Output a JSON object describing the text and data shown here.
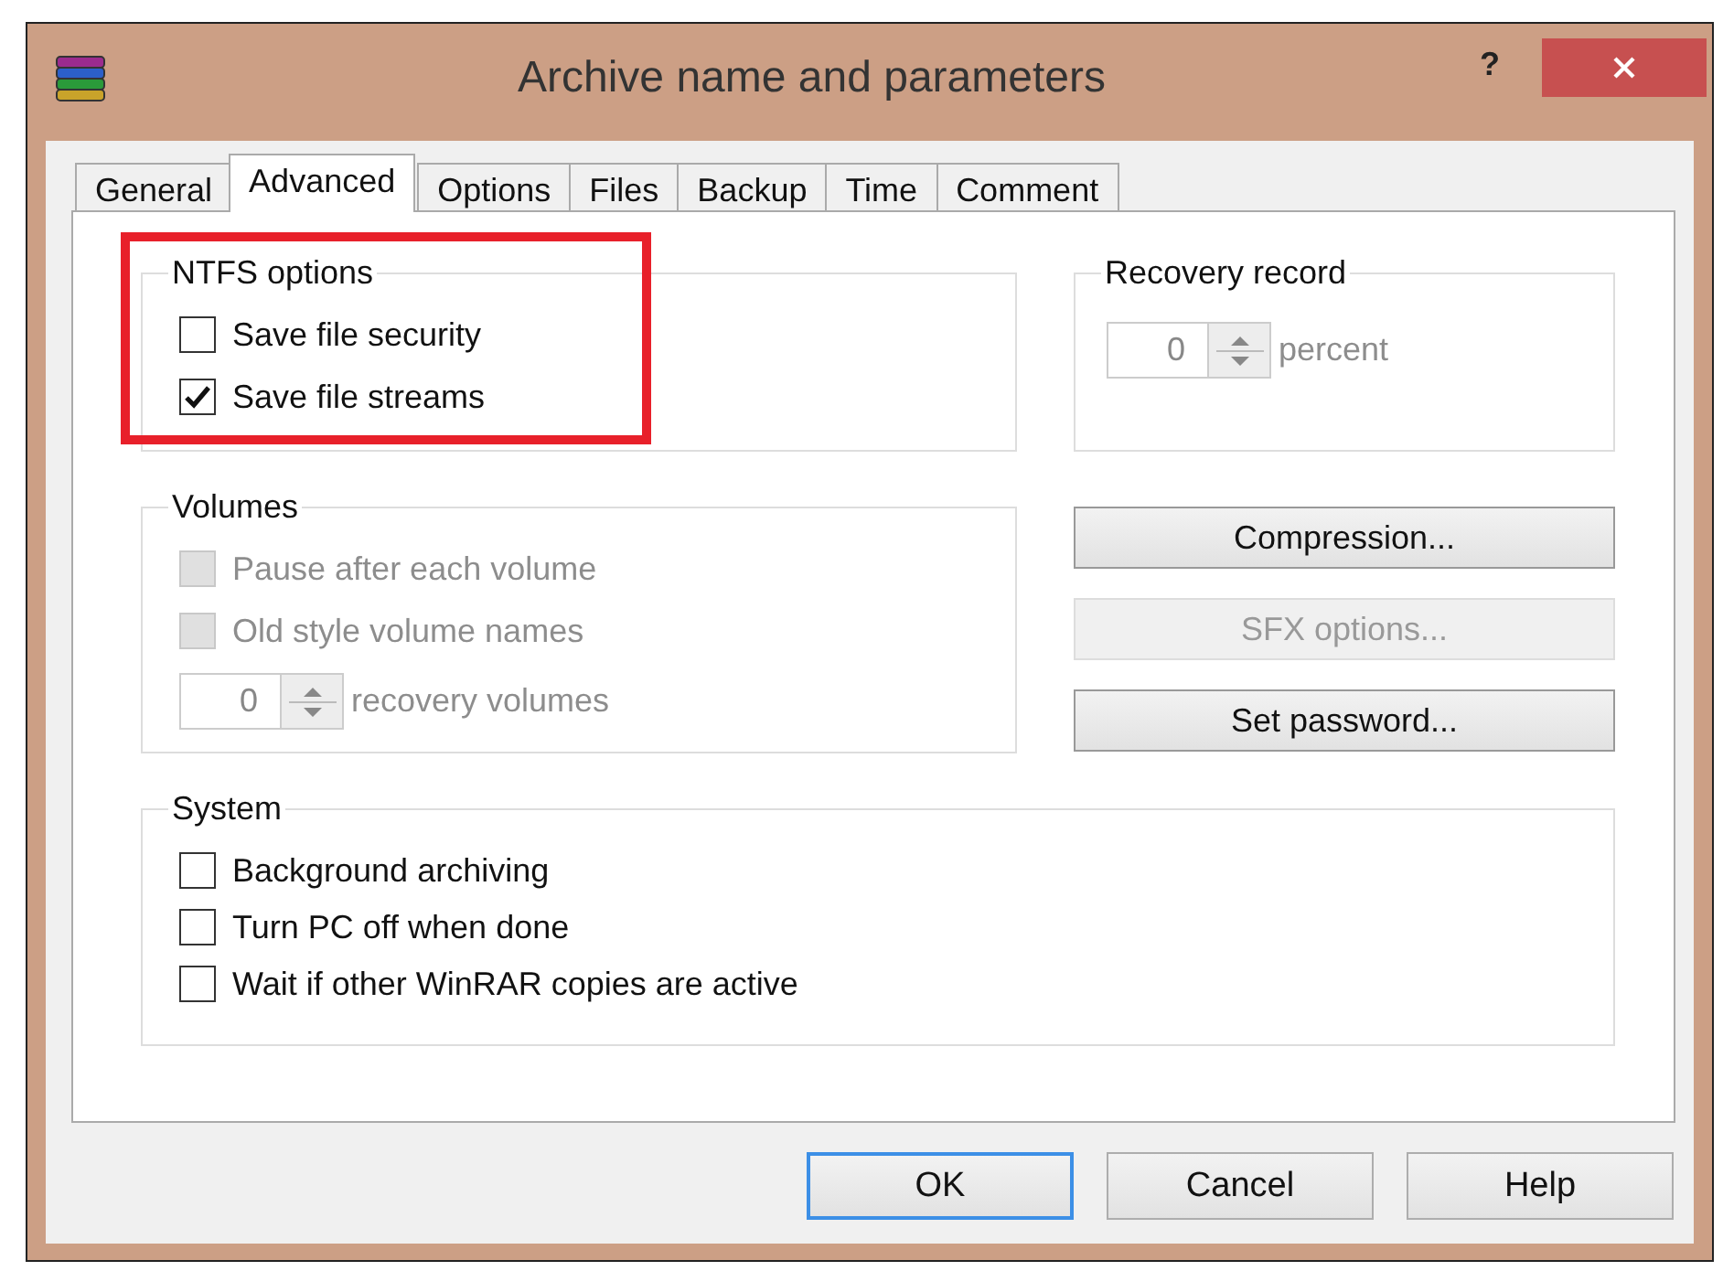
{
  "window": {
    "title": "Archive name and parameters",
    "help": "?"
  },
  "tabs": [
    {
      "label": "General",
      "selected": false
    },
    {
      "label": "Advanced",
      "selected": true
    },
    {
      "label": "Options",
      "selected": false
    },
    {
      "label": "Files",
      "selected": false
    },
    {
      "label": "Backup",
      "selected": false
    },
    {
      "label": "Time",
      "selected": false
    },
    {
      "label": "Comment",
      "selected": false
    }
  ],
  "ntfs_options": {
    "title": "NTFS options",
    "highlighted": true,
    "items": [
      {
        "label": "Save file security",
        "checked": false,
        "disabled": false
      },
      {
        "label": "Save file streams",
        "checked": true,
        "disabled": false
      }
    ]
  },
  "recovery_record": {
    "title": "Recovery record",
    "spinner": {
      "value": "0",
      "unit": "percent",
      "disabled": true
    }
  },
  "volumes": {
    "title": "Volumes",
    "items": [
      {
        "label": "Pause after each volume",
        "checked": false,
        "disabled": true
      },
      {
        "label": "Old style volume names",
        "checked": false,
        "disabled": true
      }
    ],
    "spinner": {
      "value": "0",
      "unit": "recovery volumes",
      "disabled": true
    }
  },
  "side_buttons": [
    {
      "label": "Compression...",
      "disabled": false
    },
    {
      "label": "SFX options...",
      "disabled": true
    },
    {
      "label": "Set password...",
      "disabled": false
    }
  ],
  "system": {
    "title": "System",
    "items": [
      {
        "label": "Background archiving",
        "checked": false,
        "disabled": false
      },
      {
        "label": "Turn PC off when done",
        "checked": false,
        "disabled": false
      },
      {
        "label": "Wait if other WinRAR copies are active",
        "checked": false,
        "disabled": false
      }
    ]
  },
  "dialog_buttons": [
    {
      "label": "OK",
      "default": true
    },
    {
      "label": "Cancel",
      "default": false
    },
    {
      "label": "Help",
      "default": false
    }
  ]
}
